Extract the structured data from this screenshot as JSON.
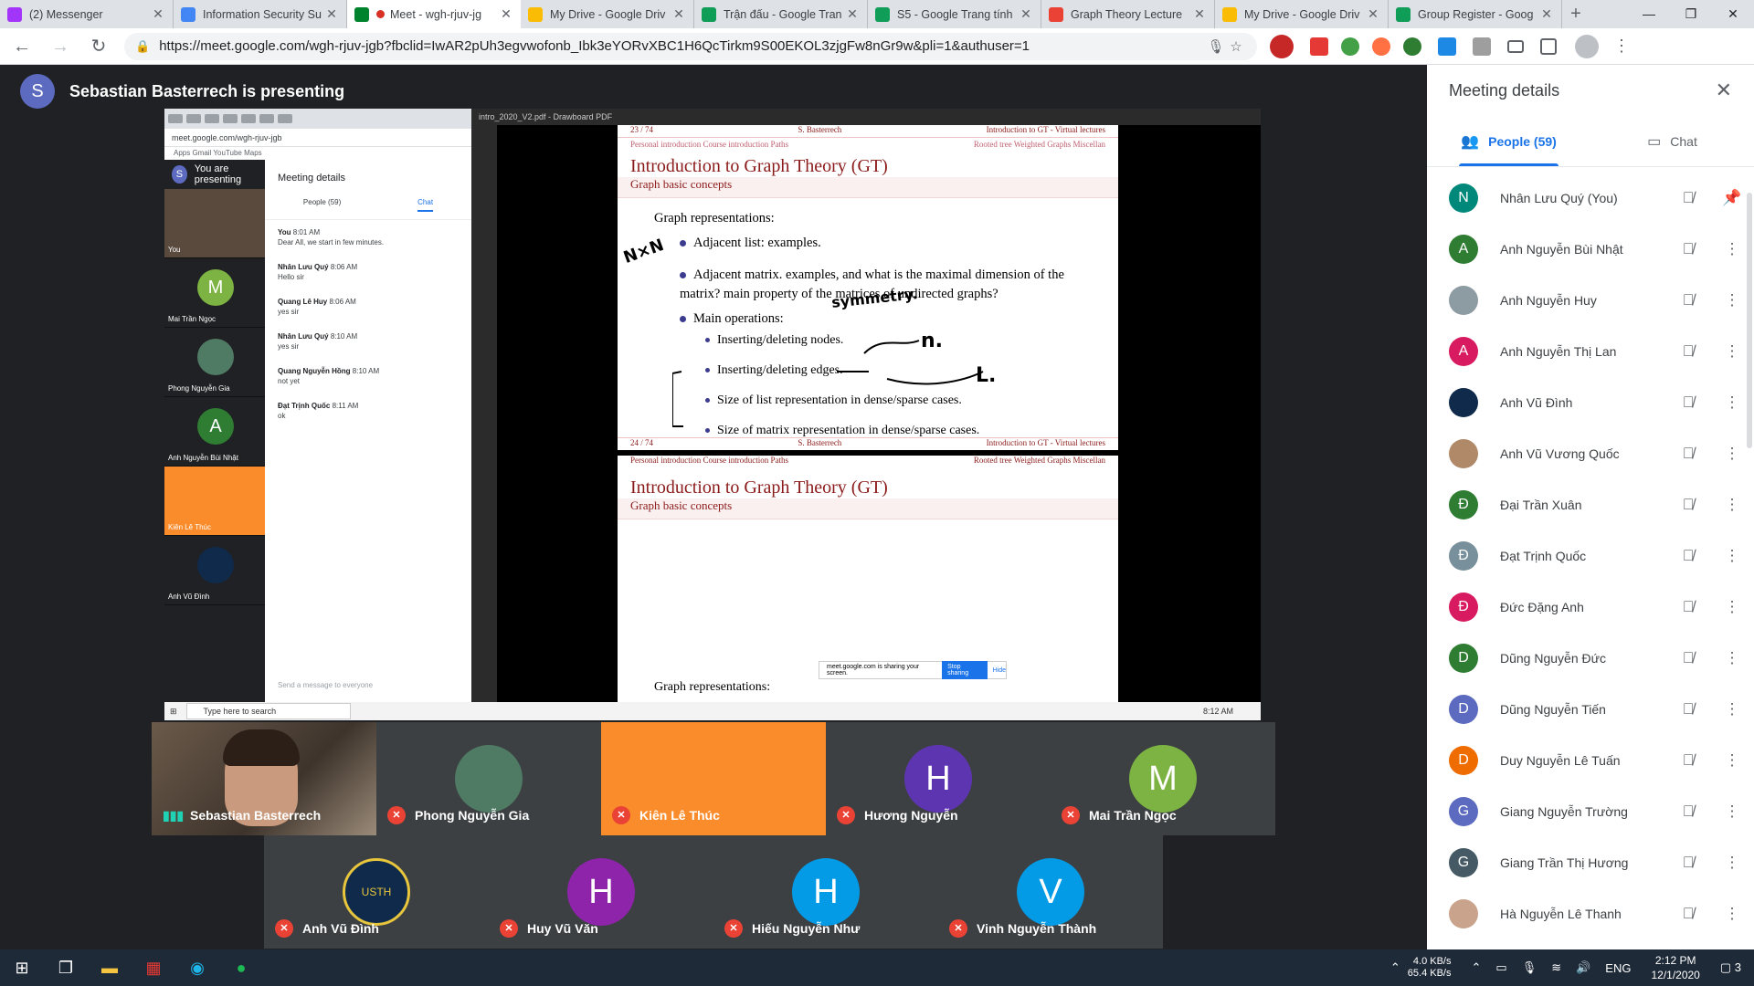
{
  "tabs": [
    {
      "title": "(2) Messenger",
      "color": "#a334fa"
    },
    {
      "title": "Information Security Su",
      "color": "#4285f4"
    },
    {
      "title": "Meet - wgh-rjuv-jg",
      "color": "#00832d",
      "active": true
    },
    {
      "title": "My Drive - Google Driv",
      "color": "#fbbc04"
    },
    {
      "title": "Trận đấu - Google Tran",
      "color": "#0f9d58"
    },
    {
      "title": "S5 - Google Trang tính",
      "color": "#0f9d58"
    },
    {
      "title": "Graph Theory Lecture",
      "color": "#ea4335"
    },
    {
      "title": "My Drive - Google Driv",
      "color": "#fbbc04"
    },
    {
      "title": "Group Register - Goog",
      "color": "#0f9d58"
    }
  ],
  "address": {
    "url": "https://meet.google.com/wgh-rjuv-jgb?fbclid=IwAR2pUh3egvwofonb_Ibk3eYORvXBC1H6QcTirkm9S00EKOL3zjgFw8nGr9w&pli=1&authuser=1"
  },
  "presenting": {
    "initial": "S",
    "text": "Sebastian Basterrech is presenting"
  },
  "shared": {
    "mini_url": "meet.google.com/wgh-rjuv-jgb",
    "bookmarks": "Apps   Gmail   YouTube   Maps",
    "you_presenting": "You are presenting",
    "meeting_details": "Meeting details",
    "people": "People (59)",
    "chat": "Chat",
    "messages": [
      {
        "who": "You",
        "time": "8:01 AM",
        "text": "Dear All, we start in few minutes."
      },
      {
        "who": "Nhân Lưu Quý",
        "time": "8:06 AM",
        "text": "Hello sir"
      },
      {
        "who": "Quang Lê Huy",
        "time": "8:06 AM",
        "text": "yes sir"
      },
      {
        "who": "Nhân Lưu Quý",
        "time": "8:10 AM",
        "text": "yes sir"
      },
      {
        "who": "Quang Nguyễn Hồng",
        "time": "8:10 AM",
        "text": "not yet"
      },
      {
        "who": "Đạt Trịnh Quốc",
        "time": "8:11 AM",
        "text": "ok"
      }
    ],
    "send_placeholder": "Send a message to everyone",
    "mini_tiles": [
      {
        "initial": "M",
        "name": "Mai Trần Ngọc",
        "color": "#7cb342"
      },
      {
        "initial": "",
        "name": "Phong Nguyễn Gia",
        "color": "#4f7a64"
      },
      {
        "initial": "A",
        "name": "Anh Nguyễn Bùi Nhật",
        "color": "#2e7d32"
      },
      {
        "initial": "",
        "name": "Kiên Lê Thúc",
        "color": "#fb8c2b"
      },
      {
        "initial": "",
        "name": "Anh Vũ Đình",
        "color": "#0f2a4a"
      }
    ],
    "pdf_title": "intro_2020_V2.pdf - Drawboard PDF",
    "slide1": {
      "page": "23 / 74",
      "author": "S. Basterrech",
      "course": "Introduction to GT - Virtual lectures",
      "nav_left": "Personal introduction   Course introduction   Paths",
      "nav_right": "Rooted tree   Weighted Graphs   Miscellan",
      "title": "Introduction to Graph Theory (GT)",
      "subtitle": "Graph basic concepts",
      "heading": "Graph representations:",
      "b1": "Adjacent list: examples.",
      "b2": "Adjacent matrix. examples, and what is the maximal dimension of the matrix? main property of the matrices of undirected graphs?",
      "b3": "Main operations:",
      "s1": "Inserting/deleting nodes.",
      "s2": "Inserting/deleting edges.",
      "s3": "Size of list representation in dense/sparse cases.",
      "s4": "Size of matrix representation in dense/sparse cases.",
      "page_bottom": "24 / 74"
    },
    "ink_nxn": "N×N",
    "ink_symmetry": "symmetry.",
    "ink_n": "n.",
    "ink_l": "L.",
    "slide2": {
      "title": "Introduction to Graph Theory (GT)",
      "subtitle": "Graph basic concepts",
      "heading": "Graph representations:"
    },
    "share_text": "meet.google.com is sharing your screen.",
    "stop_sharing": "Stop sharing",
    "hide": "Hide",
    "win_search": "Type here to search",
    "mini_time": "8:12 AM"
  },
  "tiles_row1": [
    {
      "name": "Sebastian Basterrech",
      "initial": "",
      "color": "",
      "video": true,
      "speaking": true
    },
    {
      "name": "Phong Nguyễn Gia",
      "initial": "",
      "color": "#4f7a64"
    },
    {
      "name": "Kiên Lê Thúc",
      "initial": "",
      "color": "",
      "orange": true
    },
    {
      "name": "Hương Nguyễn",
      "initial": "H",
      "color": "#5e35b1"
    },
    {
      "name": "Mai Trần Ngọc",
      "initial": "M",
      "color": "#7cb342"
    }
  ],
  "tiles_row2": [
    {
      "name": "Anh Vũ Đình",
      "initial": "USTH",
      "color": "#0f2a4a",
      "usth": true
    },
    {
      "name": "Huy Vũ Văn",
      "initial": "H",
      "color": "#8e24aa"
    },
    {
      "name": "Hiếu Nguyễn Như",
      "initial": "H",
      "color": "#039be5"
    },
    {
      "name": "Vinh Nguyễn Thành",
      "initial": "V",
      "color": "#039be5"
    }
  ],
  "panel": {
    "title": "Meeting details",
    "people_tab": "People (59)",
    "chat_tab": "Chat",
    "people": [
      {
        "name": "Nhân Lưu Quý (You)",
        "initial": "N",
        "color": "#00897b"
      },
      {
        "name": "Anh Nguyễn Bùi Nhật",
        "initial": "A",
        "color": "#2e7d32"
      },
      {
        "name": "Anh Nguyễn Huy",
        "initial": "",
        "color": "#8d9ba3"
      },
      {
        "name": "Anh Nguyễn Thị Lan",
        "initial": "A",
        "color": "#d81b60"
      },
      {
        "name": "Anh Vũ Đình",
        "initial": "",
        "color": "#0f2a4a"
      },
      {
        "name": "Anh Vũ Vương Quốc",
        "initial": "",
        "color": "#b08968"
      },
      {
        "name": "Đại Trần Xuân",
        "initial": "Đ",
        "color": "#2e7d32"
      },
      {
        "name": "Đạt Trịnh Quốc",
        "initial": "Đ",
        "color": "#78909c"
      },
      {
        "name": "Đức Đặng Anh",
        "initial": "Đ",
        "color": "#d81b60"
      },
      {
        "name": "Dũng Nguyễn Đức",
        "initial": "D",
        "color": "#2e7d32"
      },
      {
        "name": "Dũng Nguyễn Tiến",
        "initial": "D",
        "color": "#5c6bc0"
      },
      {
        "name": "Duy Nguyễn Lê Tuấn",
        "initial": "D",
        "color": "#ef6c00"
      },
      {
        "name": "Giang Nguyễn Trường",
        "initial": "G",
        "color": "#5c6bc0"
      },
      {
        "name": "Giang Trần Thị Hương",
        "initial": "G",
        "color": "#455a64"
      },
      {
        "name": "Hà Nguyễn Lê Thanh",
        "initial": "",
        "color": "#c9a38c"
      }
    ]
  },
  "taskbar": {
    "net_up": "4.0 KB/s",
    "net_down": "65.4 KB/s",
    "lang": "ENG",
    "time": "2:12 PM",
    "date": "12/1/2020",
    "notif": "3"
  }
}
